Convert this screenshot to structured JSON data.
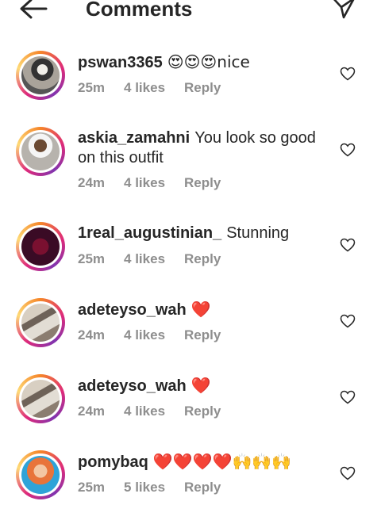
{
  "header": {
    "title": "Comments"
  },
  "comments": [
    {
      "user": "pswan3365",
      "text": "😍😍😍nice",
      "time": "25m",
      "likes": "4 likes",
      "reply": "Reply"
    },
    {
      "user": "askia_zamahni",
      "text": "You look so good on this outfit",
      "time": "24m",
      "likes": "4 likes",
      "reply": "Reply"
    },
    {
      "user": "1real_augustinian_",
      "text": "Stunning",
      "time": "25m",
      "likes": "4 likes",
      "reply": "Reply"
    },
    {
      "user": "adeteyso_wah",
      "text": "❤️",
      "time": "24m",
      "likes": "4 likes",
      "reply": "Reply"
    },
    {
      "user": "adeteyso_wah",
      "text": "❤️",
      "time": "24m",
      "likes": "4 likes",
      "reply": "Reply"
    },
    {
      "user": "pomybaq",
      "text": "❤️❤️❤️❤️🙌🙌🙌",
      "time": "25m",
      "likes": "5 likes",
      "reply": "Reply"
    }
  ],
  "colors": {
    "text": "#262626",
    "meta": "#8e8e8e",
    "heart_emoji": "#e0245e"
  },
  "icons": {
    "back": "arrow-left-icon",
    "send": "paper-plane-icon",
    "like": "heart-outline-icon"
  }
}
